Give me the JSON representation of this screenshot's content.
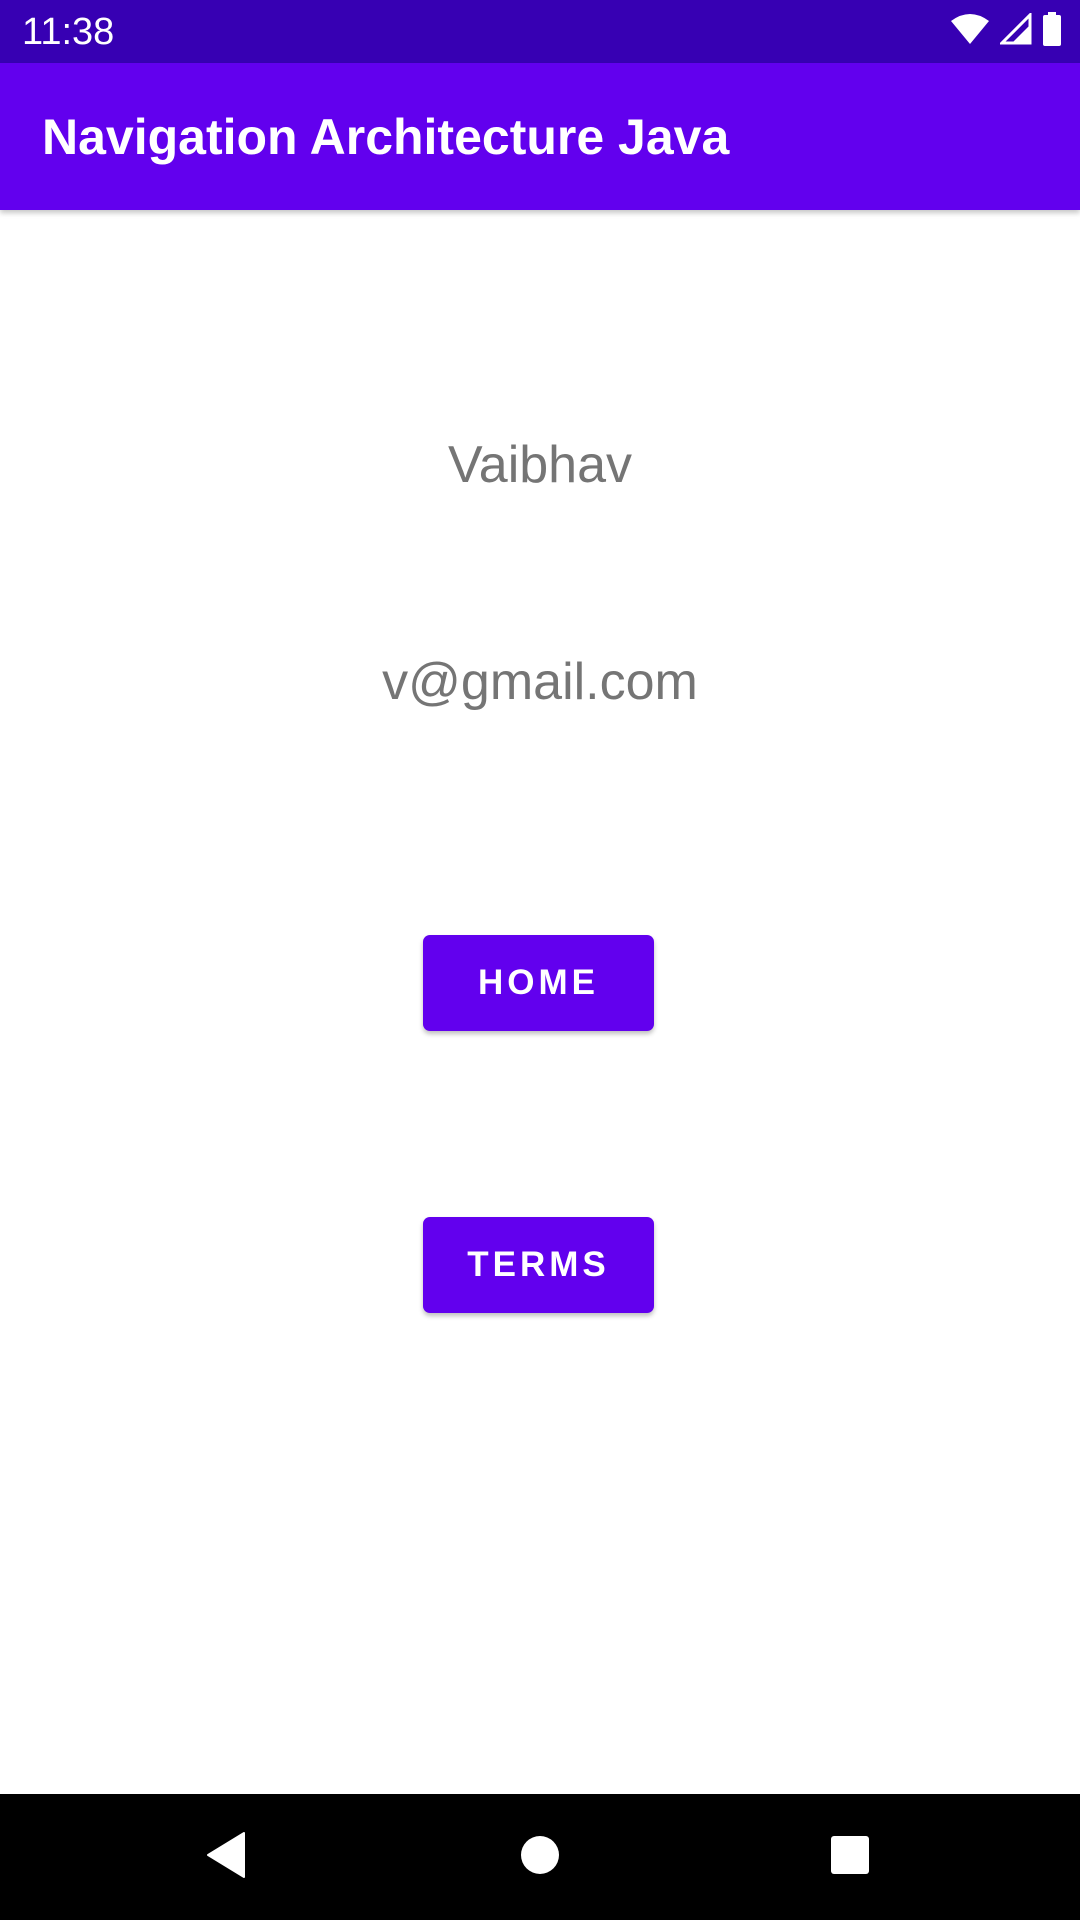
{
  "status_bar": {
    "time": "11:38",
    "icons": [
      "wifi-icon",
      "signal-icon",
      "battery-icon"
    ],
    "background": "#3700b3"
  },
  "app_bar": {
    "title": "Navigation Architecture Java",
    "background": "#6200ee"
  },
  "profile": {
    "name": "Vaibhav",
    "email": "v@gmail.com"
  },
  "buttons": {
    "home_label": "HOME",
    "terms_label": "TERMS",
    "background": "#6200ee"
  },
  "nav_bar": {
    "icons": [
      "back-icon",
      "home-circle-icon",
      "recents-icon"
    ]
  }
}
